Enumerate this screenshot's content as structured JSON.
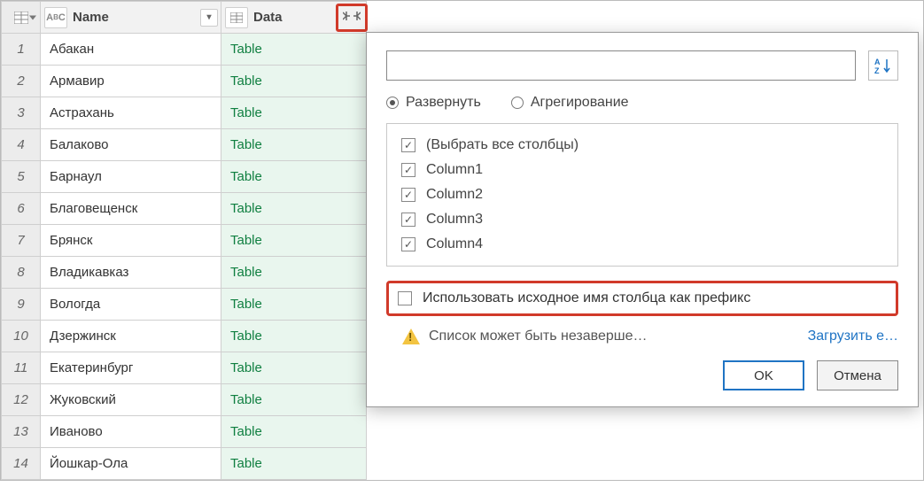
{
  "columns": {
    "name": {
      "label": "Name",
      "type_icon": "ABC"
    },
    "data": {
      "label": "Data",
      "type_icon": "table"
    }
  },
  "rows": [
    {
      "n": "1",
      "name": "Абакан",
      "data": "Table"
    },
    {
      "n": "2",
      "name": "Армавир",
      "data": "Table"
    },
    {
      "n": "3",
      "name": "Астрахань",
      "data": "Table"
    },
    {
      "n": "4",
      "name": "Балаково",
      "data": "Table"
    },
    {
      "n": "5",
      "name": "Барнаул",
      "data": "Table"
    },
    {
      "n": "6",
      "name": "Благовещенск",
      "data": "Table"
    },
    {
      "n": "7",
      "name": "Брянск",
      "data": "Table"
    },
    {
      "n": "8",
      "name": "Владикавказ",
      "data": "Table"
    },
    {
      "n": "9",
      "name": "Вологда",
      "data": "Table"
    },
    {
      "n": "10",
      "name": "Дзержинск",
      "data": "Table"
    },
    {
      "n": "11",
      "name": "Екатеринбург",
      "data": "Table"
    },
    {
      "n": "12",
      "name": "Жуковский",
      "data": "Table"
    },
    {
      "n": "13",
      "name": "Иваново",
      "data": "Table"
    },
    {
      "n": "14",
      "name": "Йошкар-Ола",
      "data": "Table"
    }
  ],
  "popup": {
    "search_placeholder": "",
    "radio_expand": "Развернуть",
    "radio_aggregate": "Агрегирование",
    "select_all": "(Выбрать все столбцы)",
    "cols": [
      "Column1",
      "Column2",
      "Column3",
      "Column4"
    ],
    "prefix": "Использовать исходное имя столбца как префикс",
    "warn": "Список может быть незаверше…",
    "load_more": "Загрузить е…",
    "ok": "OK",
    "cancel": "Отмена",
    "sort_label": "A↓Z"
  }
}
